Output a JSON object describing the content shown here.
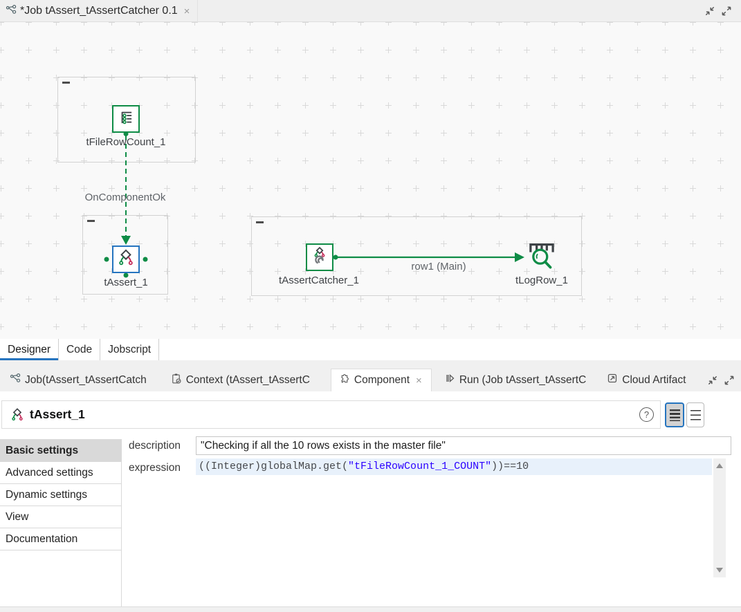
{
  "editor_tab": {
    "title": "*Job tAssert_tAssertCatcher 0.1",
    "close_glyph": "×"
  },
  "canvas": {
    "components": [
      {
        "label": "tFileRowCount_1",
        "icon": "file-row-count-icon",
        "selected": false
      },
      {
        "label": "tAssert_1",
        "icon": "assert-icon",
        "selected": true
      },
      {
        "label": "tAssertCatcher_1",
        "icon": "assert-catcher-icon",
        "selected": false
      },
      {
        "label": "tLogRow_1",
        "icon": "log-row-icon",
        "selected": false
      }
    ],
    "connections": [
      {
        "label": "OnComponentOk",
        "style": "dashed-trigger"
      },
      {
        "label": "row1 (Main)",
        "style": "solid-main"
      }
    ]
  },
  "view_tabs": {
    "items": [
      {
        "label": "Designer",
        "selected": true
      },
      {
        "label": "Code",
        "selected": false
      },
      {
        "label": "Jobscript",
        "selected": false
      }
    ]
  },
  "panel_tabs": {
    "items": [
      {
        "label": "Job(tAssert_tAssertCatch",
        "icon": "job-icon",
        "selected": false
      },
      {
        "label": "Context (tAssert_tAssertC",
        "icon": "context-icon",
        "selected": false
      },
      {
        "label": "Component",
        "icon": "component-icon",
        "selected": true,
        "close_glyph": "×"
      },
      {
        "label": "Run (Job tAssert_tAssertC",
        "icon": "run-icon",
        "selected": false
      },
      {
        "label": "Cloud Artifact",
        "icon": "cloud-artifact-icon",
        "selected": false
      }
    ]
  },
  "component_view": {
    "title": "tAssert_1",
    "help_glyph": "?",
    "sidebar": {
      "items": [
        {
          "label": "Basic settings",
          "selected": true
        },
        {
          "label": "Advanced settings",
          "selected": false
        },
        {
          "label": "Dynamic settings",
          "selected": false
        },
        {
          "label": "View",
          "selected": false
        },
        {
          "label": "Documentation",
          "selected": false
        }
      ]
    },
    "form": {
      "description_label": "description",
      "description_value": "\"Checking if all the 10 rows exists in the master file\"",
      "expression_label": "expression",
      "expression": {
        "prefix": "((Integer)globalMap.get(",
        "string": "\"tFileRowCount_1_COUNT\"",
        "suffix": "))==10"
      }
    }
  },
  "colors": {
    "accent_green": "#0E8C46",
    "accent_blue": "#2574BF",
    "accent_red": "#C42B59",
    "string_blue": "#2A00FF",
    "selected_line_highlight": "#E8F1FB",
    "canvas_bg": "#F9F9F9",
    "bar_bg": "#F0F0F0"
  }
}
